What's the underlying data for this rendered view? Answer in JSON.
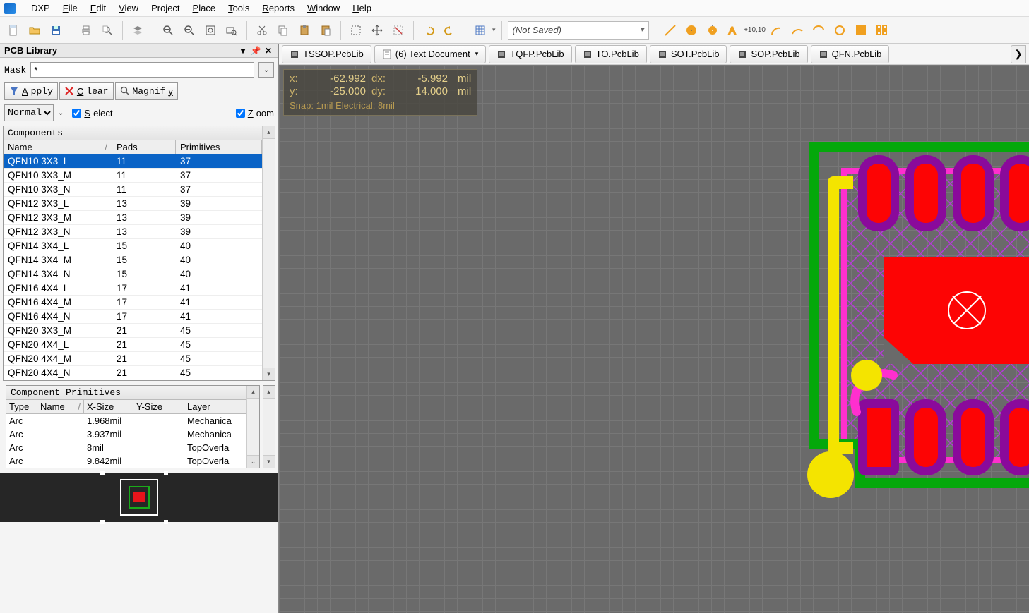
{
  "menu": {
    "dxp": "DXP",
    "file": "File",
    "edit": "Edit",
    "view": "View",
    "project": "Project",
    "place": "Place",
    "tools": "Tools",
    "reports": "Reports",
    "window": "Window",
    "help": "Help"
  },
  "toolbar": {
    "notSaved": "(Not Saved)",
    "coordLabel": "+10,10"
  },
  "tabs": [
    {
      "label": "TSSOP.PcbLib"
    },
    {
      "label": "(6) Text Document"
    },
    {
      "label": "TQFP.PcbLib"
    },
    {
      "label": "TO.PcbLib"
    },
    {
      "label": "SOT.PcbLib"
    },
    {
      "label": "SOP.PcbLib"
    },
    {
      "label": "QFN.PcbLib"
    }
  ],
  "hud": {
    "x_lab": "x:",
    "x": "-62.992",
    "dx_lab": "dx:",
    "dx": "-5.992",
    "unit": "mil",
    "y_lab": "y:",
    "y": "-25.000",
    "dy_lab": "dy:",
    "dy": "14.000",
    "snap": "Snap: 1mil Electrical: 8mil"
  },
  "panel": {
    "title": "PCB Library",
    "maskLabel": "Mask",
    "maskValue": "*",
    "apply": "Apply",
    "clear": "Clear",
    "magnify": "Magnify",
    "normal": "Normal",
    "select": "Select",
    "zoom": "Zoom",
    "componentsHeader": "Components",
    "cols": {
      "name": "Name",
      "pads": "Pads",
      "prim": "Primitives",
      "sortGlyph": "/"
    },
    "primHeader": "Component Primitives",
    "primCols": {
      "type": "Type",
      "name": "Name",
      "x": "X-Size",
      "y": "Y-Size",
      "layer": "Layer",
      "sortGlyph": "/"
    }
  },
  "components": [
    {
      "name": "QFN10 3X3_L",
      "pads": "11",
      "prim": "37",
      "sel": true
    },
    {
      "name": "QFN10 3X3_M",
      "pads": "11",
      "prim": "37"
    },
    {
      "name": "QFN10 3X3_N",
      "pads": "11",
      "prim": "37"
    },
    {
      "name": "QFN12 3X3_L",
      "pads": "13",
      "prim": "39"
    },
    {
      "name": "QFN12 3X3_M",
      "pads": "13",
      "prim": "39"
    },
    {
      "name": "QFN12 3X3_N",
      "pads": "13",
      "prim": "39"
    },
    {
      "name": "QFN14 3X4_L",
      "pads": "15",
      "prim": "40"
    },
    {
      "name": "QFN14 3X4_M",
      "pads": "15",
      "prim": "40"
    },
    {
      "name": "QFN14 3X4_N",
      "pads": "15",
      "prim": "40"
    },
    {
      "name": "QFN16 4X4_L",
      "pads": "17",
      "prim": "41"
    },
    {
      "name": "QFN16 4X4_M",
      "pads": "17",
      "prim": "41"
    },
    {
      "name": "QFN16 4X4_N",
      "pads": "17",
      "prim": "41"
    },
    {
      "name": "QFN20 3X3_M",
      "pads": "21",
      "prim": "45"
    },
    {
      "name": "QFN20 4X4_L",
      "pads": "21",
      "prim": "45"
    },
    {
      "name": "QFN20 4X4_M",
      "pads": "21",
      "prim": "45"
    },
    {
      "name": "QFN20 4X4_N",
      "pads": "21",
      "prim": "45"
    }
  ],
  "primitives": [
    {
      "type": "Arc",
      "name": "",
      "x": "1.968mil",
      "y": "",
      "layer": "Mechanica"
    },
    {
      "type": "Arc",
      "name": "",
      "x": "3.937mil",
      "y": "",
      "layer": "Mechanica"
    },
    {
      "type": "Arc",
      "name": "",
      "x": "8mil",
      "y": "",
      "layer": "TopOverla"
    },
    {
      "type": "Arc",
      "name": "",
      "x": "9.842mil",
      "y": "",
      "layer": "TopOverla"
    }
  ]
}
